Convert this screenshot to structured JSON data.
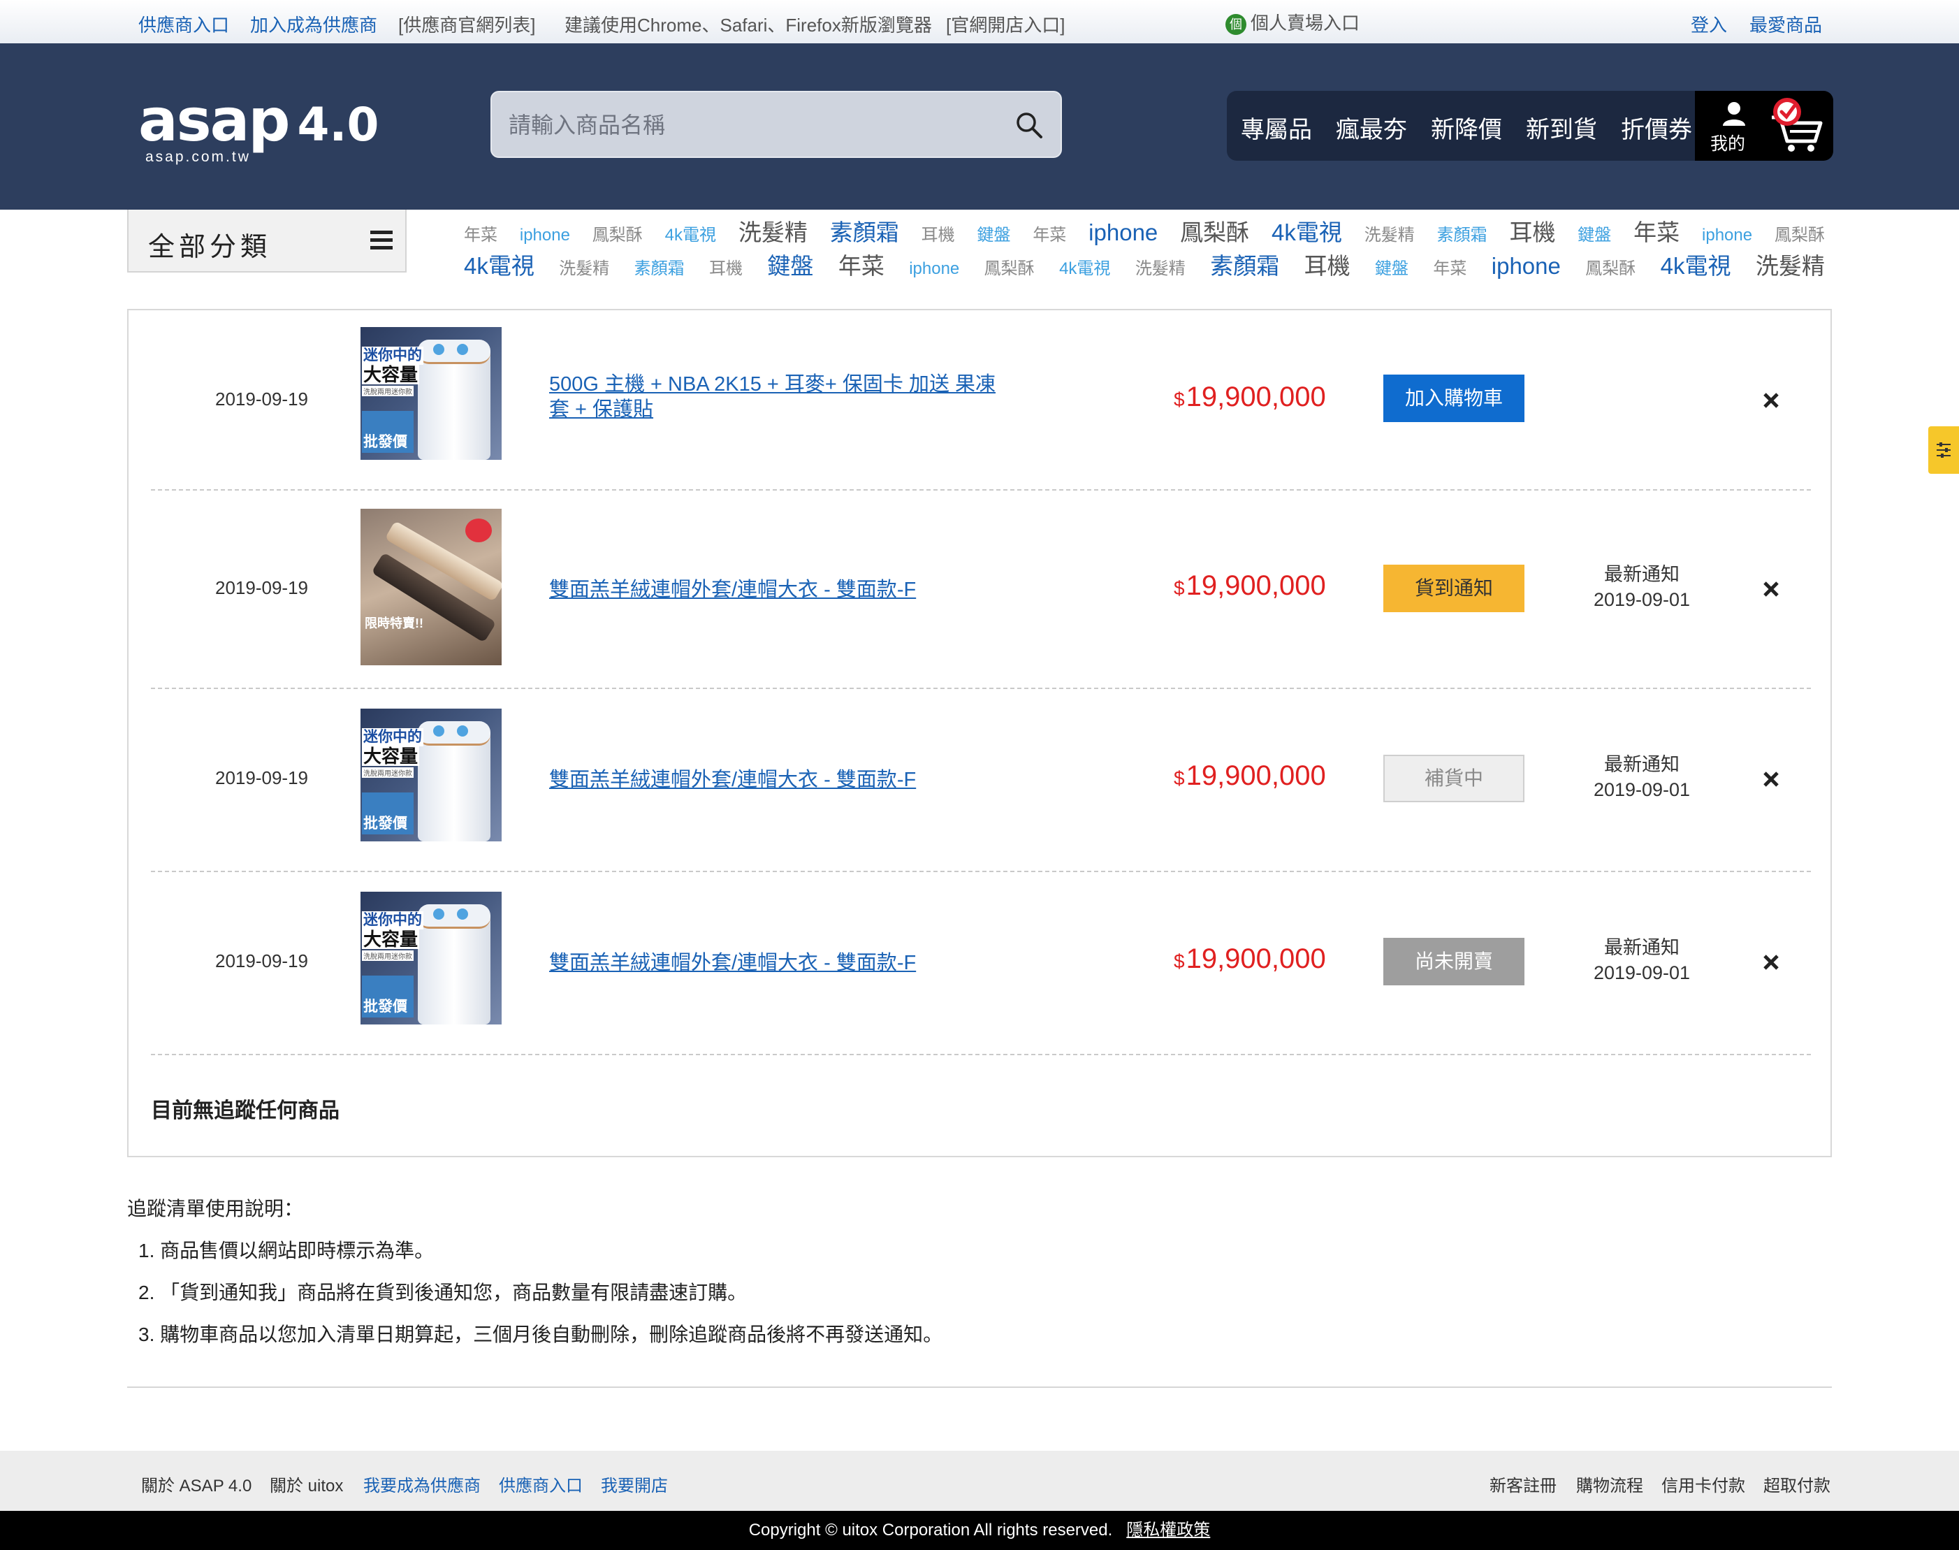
{
  "topbar": {
    "links_left": [
      "供應商入口",
      "加入成為供應商",
      "[供應商官網列表]",
      "建議使用Chrome、Safari、Firefox新版瀏覽器",
      "[官網開店入口]"
    ],
    "personal_store": "個人賣場入口",
    "personal_icon_glyph": "個",
    "login": "登入",
    "favorites": "最愛商品"
  },
  "header": {
    "logo_text": "asap",
    "logo_version": "4.0",
    "logo_domain": "asap.com.tw",
    "search_placeholder": "請輸入商品名稱",
    "nav": [
      "專屬品",
      "瘋最夯",
      "新降價",
      "新到貨",
      "折價券"
    ],
    "account_label": "我的"
  },
  "categories": {
    "button_label": "全部分類",
    "tags_row1": [
      "年菜",
      "iphone",
      "鳳梨酥",
      "4k電視",
      "洗髮精",
      "素顏霜",
      "耳機",
      "鍵盤",
      "年菜",
      "iphone",
      "鳳梨酥",
      "4k電視",
      "洗髮精",
      "素顏霜",
      "耳機",
      "鍵盤",
      "年菜",
      "iphone",
      "鳳梨酥"
    ],
    "tags_row2": [
      "4k電視",
      "洗髮精",
      "素顏霜",
      "耳機",
      "鍵盤",
      "年菜",
      "iphone",
      "鳳梨酥",
      "4k電視",
      "洗髮精",
      "素顏霜",
      "耳機",
      "鍵盤",
      "年菜",
      "iphone",
      "鳳梨酥",
      "4k電視",
      "洗髮精"
    ]
  },
  "items": [
    {
      "date": "2019-09-19",
      "title": "500G 主機 + NBA 2K15 + 耳麥+ 保固卡 加送 果凍套 + 保護貼",
      "currency": "$",
      "price": "19,900,000",
      "action": "加入購物車",
      "notice_label": "",
      "notice_date": ""
    },
    {
      "date": "2019-09-19",
      "title": "雙面羔羊絨連帽外套/連帽大衣 - 雙面款-F",
      "currency": "$",
      "price": "19,900,000",
      "action": "貨到通知",
      "notice_label": "最新通知",
      "notice_date": "2019-09-01"
    },
    {
      "date": "2019-09-19",
      "title": "雙面羔羊絨連帽外套/連帽大衣 - 雙面款-F",
      "currency": "$",
      "price": "19,900,000",
      "action": "補貨中",
      "notice_label": "最新通知",
      "notice_date": "2019-09-01"
    },
    {
      "date": "2019-09-19",
      "title": "雙面羔羊絨連帽外套/連帽大衣 - 雙面款-F",
      "currency": "$",
      "price": "19,900,000",
      "action": "尚未開賣",
      "notice_label": "最新通知",
      "notice_date": "2019-09-01"
    }
  ],
  "product_images": {
    "washer": {
      "line1": "迷你中的",
      "line2": "大容量",
      "line3": "洗脫兩用迷你款",
      "badge": "批發價"
    },
    "hair": {
      "caption": "限時特賣!!"
    }
  },
  "empty_message": "目前無追蹤任何商品",
  "instructions": {
    "heading": "追蹤清單使用說明：",
    "lines": [
      "1. 商品售價以網站即時標示為準。",
      "2. 「貨到通知我」商品將在貨到後通知您，商品數量有限請盡速訂購。",
      "3. 購物車商品以您加入清單日期算起，三個月後自動刪除，刪除追蹤商品後將不再發送通知。"
    ]
  },
  "footer": {
    "left_links": [
      "關於 ASAP 4.0",
      "關於 uitox",
      "我要成為供應商",
      "供應商入口",
      "我要開店"
    ],
    "right_links": [
      "新客註冊",
      "購物流程",
      "信用卡付款",
      "超取付款"
    ],
    "copyright": "Copyright © uitox Corporation All rights reserved.",
    "privacy": "隱私權政策"
  },
  "colors": {
    "header_bg": "#2d3e5e",
    "link_blue": "#1a62b5",
    "price_red": "#e02020",
    "cart_button": "#0f6ccf",
    "notify_button": "#f6b632",
    "unreleased_button": "#9e9e9e",
    "side_tab": "#f6c72a"
  },
  "icons": [
    "search-icon",
    "user-icon",
    "cart-icon",
    "menu-icon",
    "close-icon",
    "filter-icon"
  ]
}
